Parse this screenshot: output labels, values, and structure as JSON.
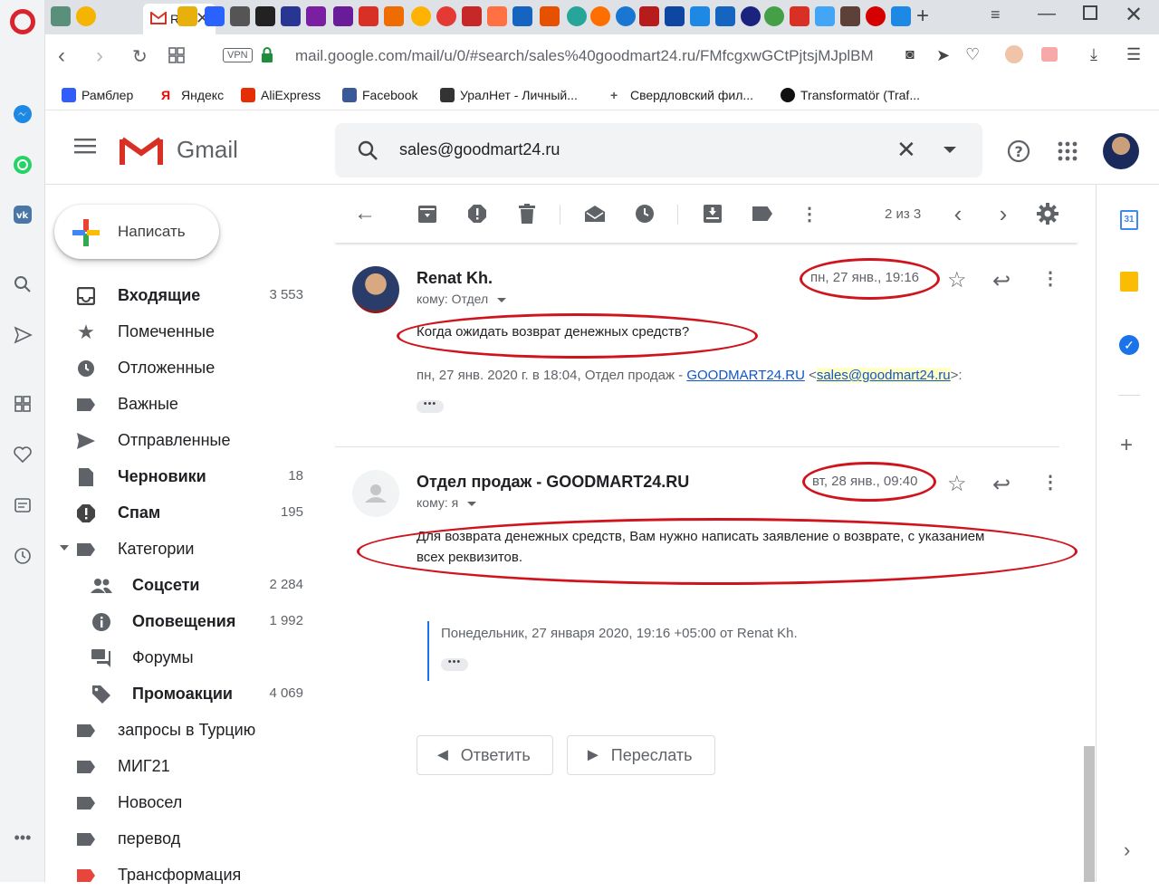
{
  "browser": {
    "active_tab_label": "Re",
    "url": "mail.google.com/mail/u/0/#search/sales%40goodmart24.ru/FMfcgxwGCtPjtsjMJplBM",
    "vpn_label": "VPN",
    "bookmarks": [
      "Рамблер",
      "Яндекс",
      "AliExpress",
      "Facebook",
      "УралНет - Личный...",
      "Свердловский фил...",
      "Transformatör (Traf..."
    ]
  },
  "gmail": {
    "logo_text": "Gmail",
    "search_value": "sales@goodmart24.ru",
    "compose_label": "Написать",
    "nav": [
      {
        "label": "Входящие",
        "count": "3 553"
      },
      {
        "label": "Помеченные",
        "count": ""
      },
      {
        "label": "Отложенные",
        "count": ""
      },
      {
        "label": "Важные",
        "count": ""
      },
      {
        "label": "Отправленные",
        "count": ""
      },
      {
        "label": "Черновики",
        "count": "18"
      },
      {
        "label": "Спам",
        "count": "195"
      },
      {
        "label": "Категории",
        "count": ""
      },
      {
        "label": "Соцсети",
        "count": "2 284"
      },
      {
        "label": "Оповещения",
        "count": "1 992"
      },
      {
        "label": "Форумы",
        "count": ""
      },
      {
        "label": "Промоакции",
        "count": "4 069"
      },
      {
        "label": "запросы в Турцию",
        "count": ""
      },
      {
        "label": "МИГ21",
        "count": ""
      },
      {
        "label": "Новосел",
        "count": ""
      },
      {
        "label": "перевод",
        "count": ""
      },
      {
        "label": "Трансформация",
        "count": ""
      }
    ],
    "pager": "2 из 3",
    "messages": [
      {
        "sender": "Renat Kh.",
        "to": "кому: Отдел",
        "date": "пн, 27 янв., 19:16",
        "body": "Когда ожидать возврат денежных средств?",
        "quote_intro": "пн, 27 янв. 2020 г. в 18:04, Отдел продаж - ",
        "quote_link": "GOODMART24.RU",
        "quote_lt": " <",
        "quote_email": "sales@goodmart24.ru",
        "quote_gt": ">:"
      },
      {
        "sender": "Отдел продаж - GOODMART24.RU",
        "to": "кому: я",
        "date": "вт, 28 янв., 09:40",
        "body_line1": "Для возврата денежных средств, Вам нужно написать заявление о возврате, с указанием",
        "body_line2": "всех реквизитов.",
        "quote": "Понедельник, 27 января 2020, 19:16 +05:00 от Renat Kh."
      }
    ],
    "reply_label": "Ответить",
    "forward_label": "Переслать",
    "ellipsis": "•••"
  }
}
